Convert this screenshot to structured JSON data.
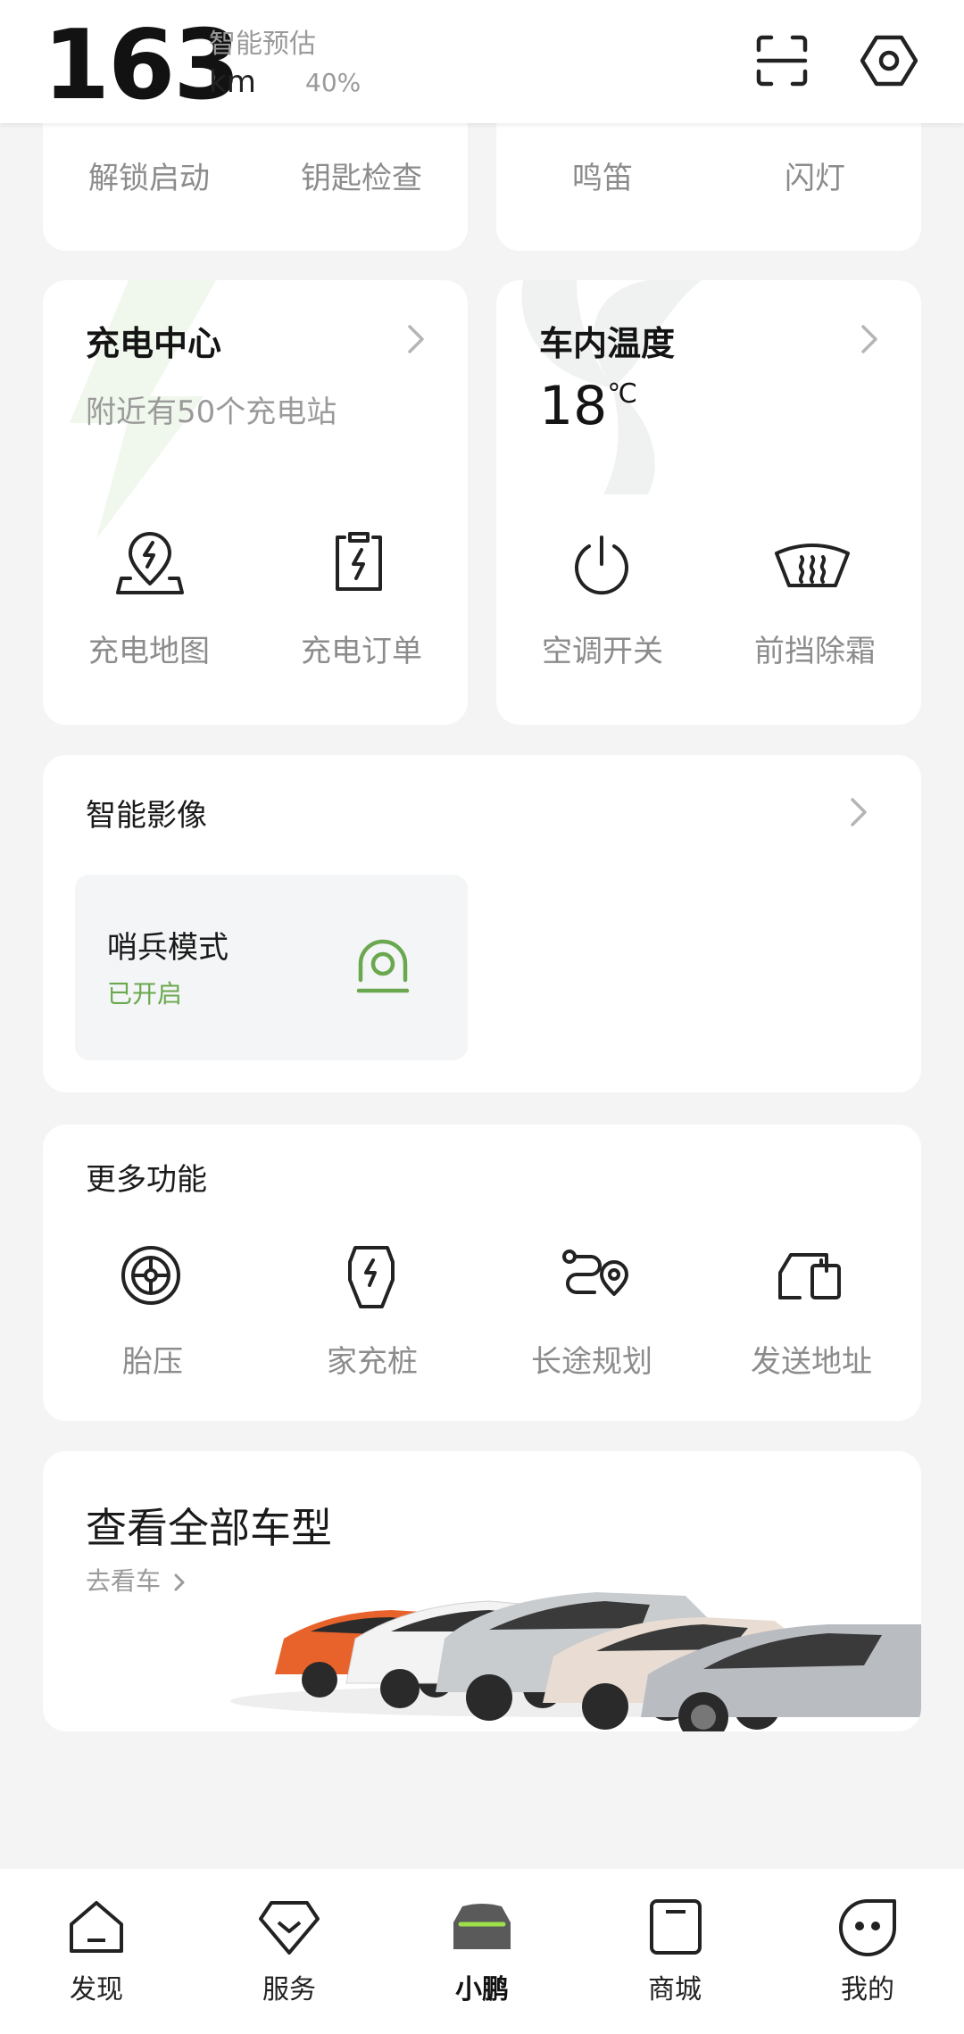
{
  "header": {
    "range_value": "163",
    "range_unit": "km",
    "range_label": "智能预估",
    "battery_percent": "40%"
  },
  "quick_actions": {
    "items": [
      "解锁启动",
      "钥匙检查",
      "鸣笛",
      "闪灯"
    ]
  },
  "charging": {
    "title": "充电中心",
    "subtitle": "附近有50个充电站",
    "items": [
      "充电地图",
      "充电订单"
    ]
  },
  "climate": {
    "title": "车内温度",
    "temperature": "18",
    "temperature_unit": "℃",
    "items": [
      "空调开关",
      "前挡除霜"
    ]
  },
  "imaging": {
    "title": "智能影像",
    "sentry_title": "哨兵模式",
    "sentry_status": "已开启"
  },
  "more": {
    "title": "更多功能",
    "items": [
      "胎压",
      "家充桩",
      "长途规划",
      "发送地址"
    ]
  },
  "models": {
    "title": "查看全部车型",
    "link": "去看车"
  },
  "tabs": [
    "发现",
    "服务",
    "小鹏",
    "商城",
    "我的"
  ],
  "colors": {
    "accent_green": "#6aa84f",
    "active_tab_accent": "#9ee04a",
    "card_bg": "#ffffff",
    "page_bg": "#f4f4f5"
  }
}
